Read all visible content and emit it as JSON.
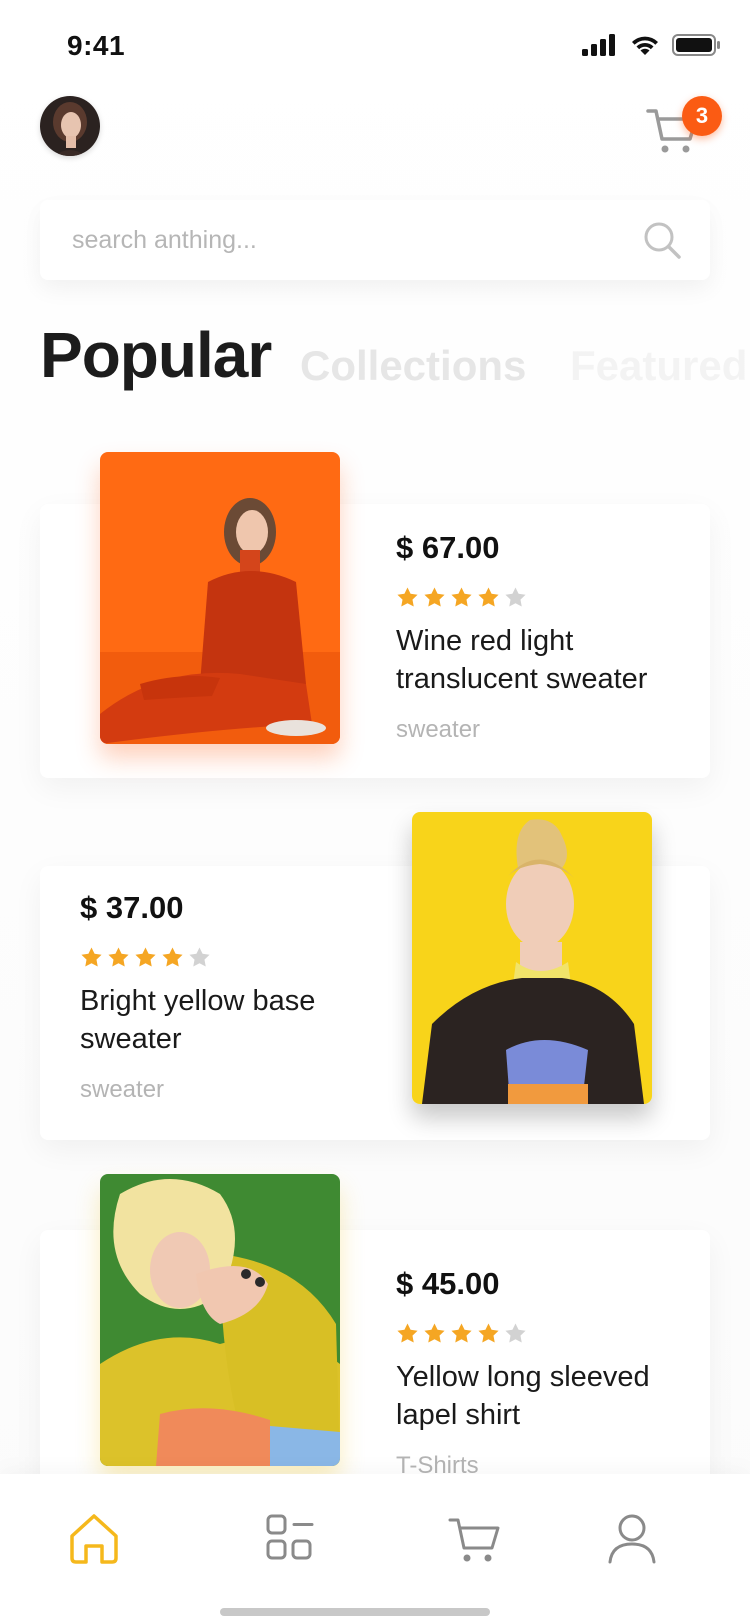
{
  "status_bar": {
    "time": "9:41"
  },
  "header": {
    "avatar_icon": "avatar",
    "cart_icon": "cart-icon",
    "cart_count": "3"
  },
  "search": {
    "placeholder": "search anthing...",
    "value": ""
  },
  "tabs": [
    {
      "label": "Popular",
      "active": true
    },
    {
      "label": "Collections",
      "active": false
    },
    {
      "label": "Featured",
      "active": false
    }
  ],
  "products": [
    {
      "price": "$ 67.00",
      "rating": 4,
      "rating_max": 5,
      "name": "Wine red light translucent sweater",
      "category": "sweater",
      "image_bg": "#ff6a13"
    },
    {
      "price": "$ 37.00",
      "rating": 4,
      "rating_max": 5,
      "name": "Bright yellow base sweater",
      "category": "sweater",
      "image_bg": "#f8d41a"
    },
    {
      "price": "$ 45.00",
      "rating": 4,
      "rating_max": 5,
      "name": "Yellow long sleeved lapel shirt",
      "category": "T-Shirts",
      "image_bg": "#3f8a32"
    }
  ],
  "bottom_nav": [
    {
      "icon": "home-icon",
      "active": true
    },
    {
      "icon": "categories-icon",
      "active": false
    },
    {
      "icon": "cart-icon",
      "active": false
    },
    {
      "icon": "profile-icon",
      "active": false
    }
  ],
  "colors": {
    "accent": "#fb5b13",
    "star": "#f5a623",
    "star_empty": "#d2d2d2",
    "nav_active": "#f5b81c",
    "nav_inactive": "#8a8a8a"
  }
}
